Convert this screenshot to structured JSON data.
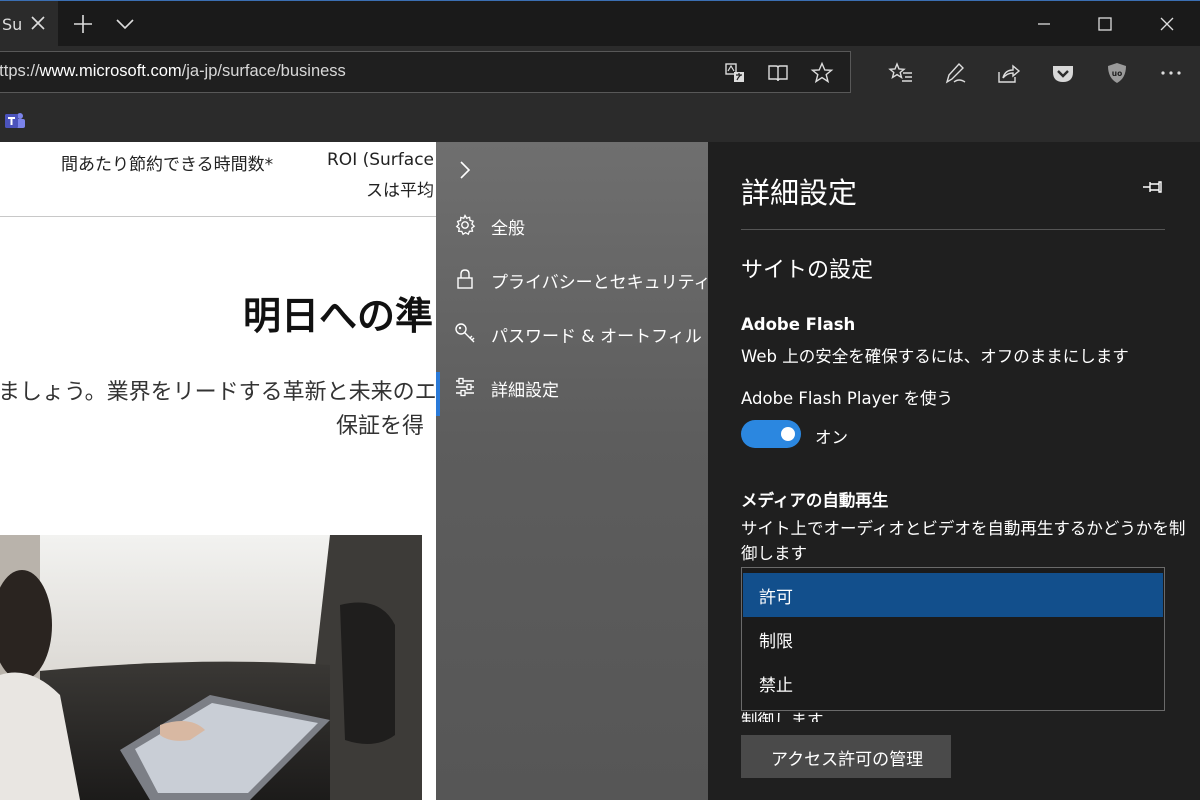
{
  "tab": {
    "title": "Su"
  },
  "address_bar": {
    "prefix": "https://",
    "host": "www.microsoft.com",
    "path": "/ja-jp/surface/business"
  },
  "page": {
    "col1": "間あたり節約できる時間数*",
    "col2_line1": "ROI (Surface",
    "col2_line2": "スは平均",
    "heading": "明日への準",
    "body_line1": "ましょう。業界をリードする革新と未来のエク",
    "body_line2": "保証を得"
  },
  "settings_nav": {
    "items": [
      {
        "label": "全般",
        "icon": "gear-icon"
      },
      {
        "label": "プライバシーとセキュリティ",
        "icon": "lock-icon"
      },
      {
        "label": "パスワード & オートフィル",
        "icon": "key-icon"
      },
      {
        "label": "詳細設定",
        "icon": "sliders-icon"
      }
    ],
    "active_index": 3
  },
  "settings": {
    "title": "詳細設定",
    "section": "サイトの設定",
    "flash": {
      "heading": "Adobe Flash",
      "desc": "Web 上の安全を確保するには、オフのままにします",
      "toggle_label": "Adobe Flash Player を使う",
      "toggle_state": "オン",
      "toggle_on": true
    },
    "media": {
      "heading": "メディアの自動再生",
      "desc_line1": "サイト上でオーディオとビデオを自動再生するかどうかを制",
      "desc_line2": "御します",
      "options": [
        "許可",
        "制限",
        "禁止"
      ],
      "selected": "許可"
    },
    "cut_text": "制御します",
    "perm_button": "アクセス許可の管理"
  },
  "colors": {
    "accent": "#2b87e0",
    "selection": "#124f8c",
    "pane_bg": "#1f1f1f"
  }
}
